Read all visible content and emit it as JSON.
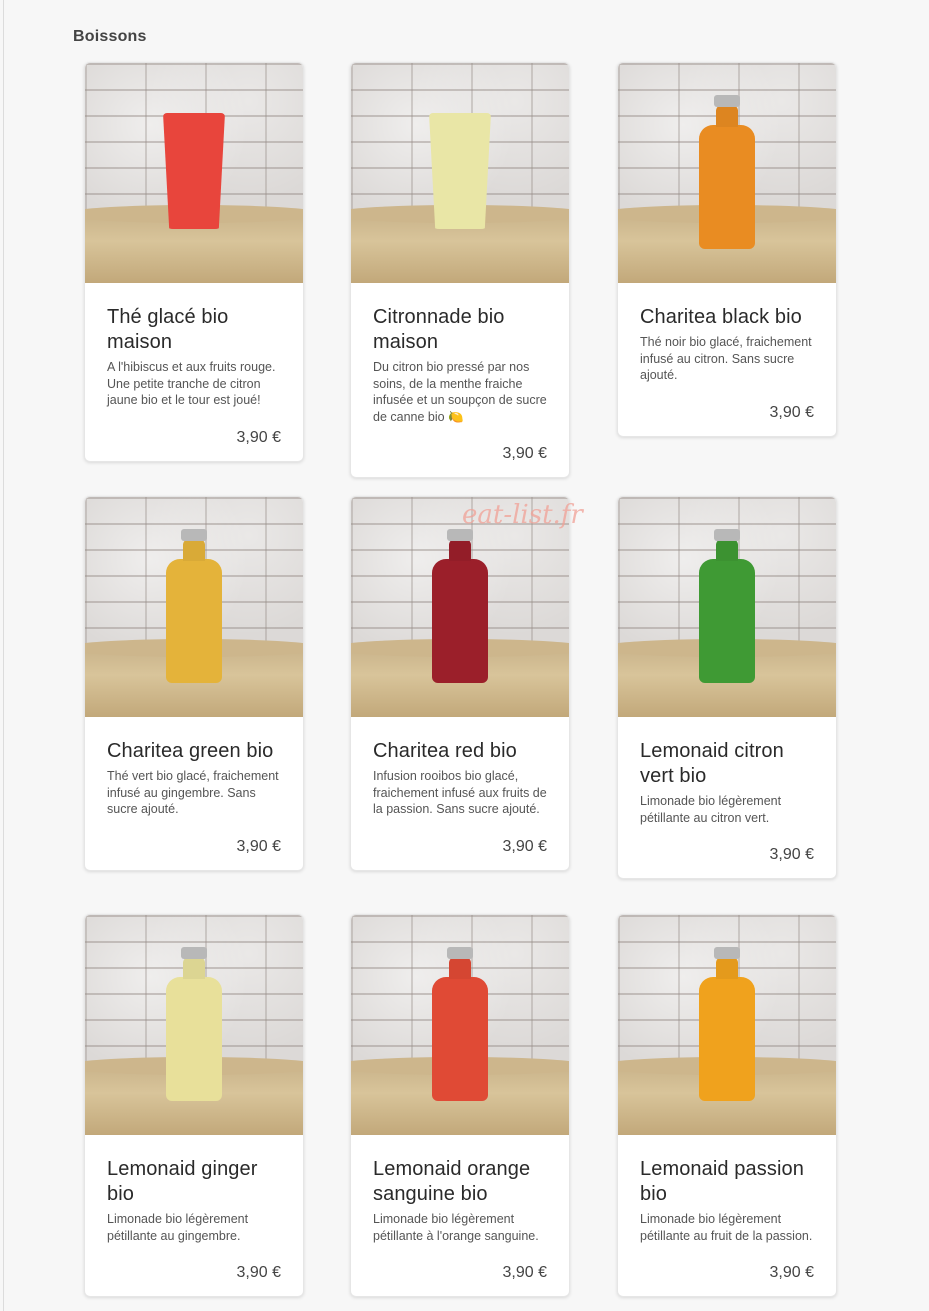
{
  "section": {
    "title": "Boissons"
  },
  "watermark": "eat-list.fr",
  "products": [
    {
      "name": "Thé glacé bio maison",
      "description": "A l'hibiscus et aux fruits rouge. Une petite tranche de citron jaune bio et le tour est joué!",
      "price": "3,90 €",
      "image": "red-iced-tea-cup",
      "color": "#e8453c"
    },
    {
      "name": "Citronnade bio maison",
      "description": "Du citron bio pressé par nos soins, de la menthe fraiche infusée et un soupçon de sucre de canne bio 🍋",
      "price": "3,90 €",
      "image": "lemonade-cup",
      "color": "#e9e6a6"
    },
    {
      "name": "Charitea black bio",
      "description": "Thé noir bio glacé, fraichement infusé au citron. Sans sucre ajouté.",
      "price": "3,90 €",
      "image": "orange-bottle",
      "color": "#e98c22"
    },
    {
      "name": "Charitea green bio",
      "description": "Thé vert bio glacé, fraichement infusé au gingembre. Sans sucre ajouté.",
      "price": "3,90 €",
      "image": "yellow-bottle",
      "color": "#e4b33a"
    },
    {
      "name": "Charitea red bio",
      "description": "Infusion rooibos bio glacé, fraichement infusé aux fruits de la passion. Sans sucre ajouté.",
      "price": "3,90 €",
      "image": "dark-red-bottle",
      "color": "#9b1f2a"
    },
    {
      "name": "Lemonaid citron vert bio",
      "description": "Limonade bio légèrement pétillante au citron vert.",
      "price": "3,90 €",
      "image": "green-bottle",
      "color": "#3f9a34"
    },
    {
      "name": "Lemonaid ginger bio",
      "description": "Limonade bio légèrement pétillante au gingembre.",
      "price": "3,90 €",
      "image": "pale-yellow-bottle",
      "color": "#e8e09a"
    },
    {
      "name": "Lemonaid orange sanguine bio",
      "description": "Limonade bio légèrement pétillante à l'orange sanguine.",
      "price": "3,90 €",
      "image": "blood-orange-bottle",
      "color": "#e04a35"
    },
    {
      "name": "Lemonaid passion bio",
      "description": "Limonade bio légèrement pétillante au fruit de la passion.",
      "price": "3,90 €",
      "image": "passion-orange-bottle",
      "color": "#f0a21d"
    }
  ]
}
